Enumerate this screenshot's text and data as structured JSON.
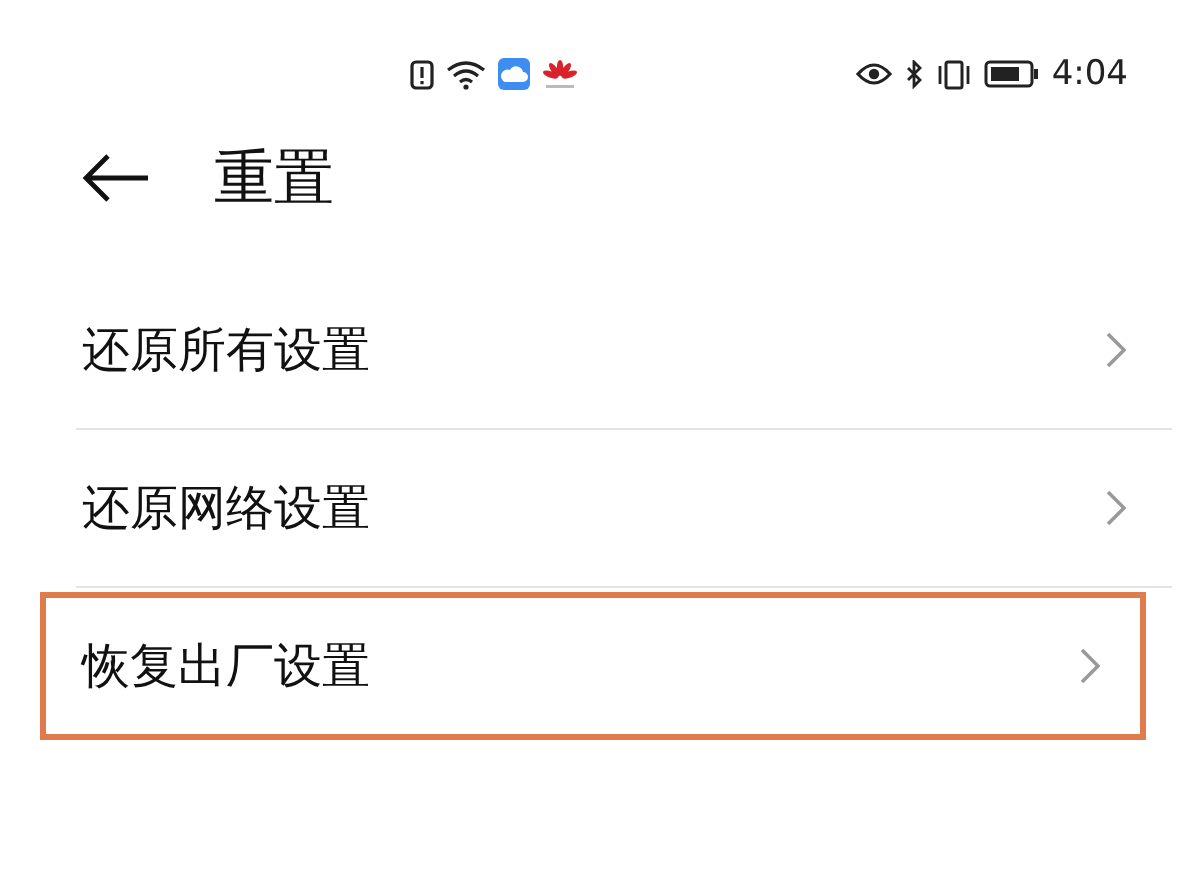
{
  "status_bar": {
    "time": "4:04"
  },
  "header": {
    "title": "重置"
  },
  "items": [
    {
      "label": "还原所有设置",
      "highlighted": false
    },
    {
      "label": "还原网络设置",
      "highlighted": false
    },
    {
      "label": "恢复出厂设置",
      "highlighted": true
    }
  ]
}
